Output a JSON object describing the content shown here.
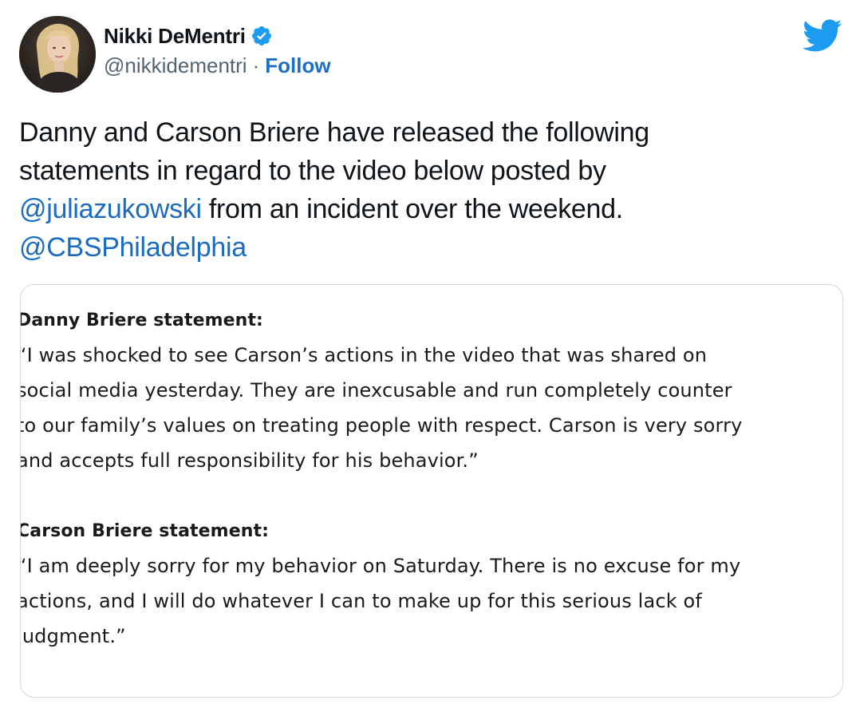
{
  "author": {
    "display_name": "Nikki DeMentri",
    "handle": "@nikkidementri",
    "separator": "·",
    "follow_label": "Follow",
    "verified": true
  },
  "icons": {
    "avatar": "profile-photo",
    "verified": "verified-badge-icon",
    "brand": "twitter-bird-icon"
  },
  "colors": {
    "link": "#1b6cc0",
    "twitter_blue": "#1d9bf0",
    "muted_text": "#536471",
    "border": "#cfd9de"
  },
  "tweet": {
    "line1": "Danny and Carson Briere have released the following",
    "line2": "statements in regard to the video below posted by",
    "mention1": "@juliazukowski",
    "line3_rest": " from an incident over the weekend.",
    "mention2": "@CBSPhiladelphia"
  },
  "media": {
    "danny_heading": "Danny Briere statement:",
    "danny_lines": [
      "“I was shocked to see Carson’s actions in the video that was shared on",
      "social media yesterday. They are inexcusable and run completely counter",
      "to our family’s values on treating people with respect. Carson is very sorry",
      "and accepts full responsibility for his behavior.”"
    ],
    "carson_heading": "Carson Briere statement:",
    "carson_lines": [
      "“I am deeply sorry for my behavior on Saturday. There is no excuse for my",
      "actions, and I will do whatever I can to make up for this serious lack of",
      "judgment.”"
    ]
  }
}
